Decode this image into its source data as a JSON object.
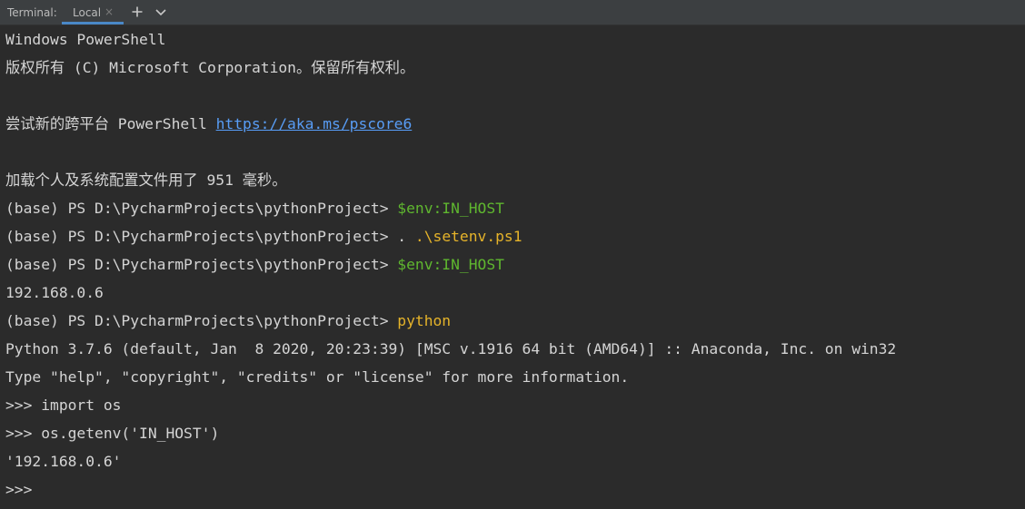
{
  "header": {
    "title": "Terminal:",
    "tab_label": "Local",
    "tab_close": "×",
    "new_tab_icon": "plus-icon",
    "dropdown_icon": "chevron-down-icon"
  },
  "colors": {
    "background": "#2b2b2b",
    "text": "#d4d4d4",
    "command_green": "#5fb72f",
    "command_yellow": "#e5b32a",
    "link": "#589df6",
    "tab_underline": "#4a88c7"
  },
  "terminal": {
    "lines": [
      {
        "text": "Windows PowerShell"
      },
      {
        "text": "版权所有 (C) Microsoft Corporation。保留所有权利。"
      },
      {
        "text": ""
      },
      {
        "prefix": "尝试新的跨平台 PowerShell ",
        "link": "https://aka.ms/pscore6"
      },
      {
        "text": ""
      },
      {
        "text": "加载个人及系统配置文件用了 951 毫秒。"
      },
      {
        "prompt": "(base) PS D:\\PycharmProjects\\pythonProject> ",
        "command": "$env:IN_HOST",
        "command_color": "green"
      },
      {
        "prompt": "(base) PS D:\\PycharmProjects\\pythonProject> ",
        "command_plain": ". ",
        "command": ".\\setenv.ps1",
        "command_color": "yellow"
      },
      {
        "prompt": "(base) PS D:\\PycharmProjects\\pythonProject> ",
        "command": "$env:IN_HOST",
        "command_color": "green"
      },
      {
        "text": "192.168.0.6"
      },
      {
        "prompt": "(base) PS D:\\PycharmProjects\\pythonProject> ",
        "command": "python",
        "command_color": "yellow"
      },
      {
        "text": "Python 3.7.6 (default, Jan  8 2020, 20:23:39) [MSC v.1916 64 bit (AMD64)] :: Anaconda, Inc. on win32"
      },
      {
        "text": "Type \"help\", \"copyright\", \"credits\" or \"license\" for more information."
      },
      {
        "text": ">>> import os"
      },
      {
        "text": ">>> os.getenv('IN_HOST')"
      },
      {
        "text": "'192.168.0.6'"
      },
      {
        "text": ">>>"
      }
    ]
  }
}
